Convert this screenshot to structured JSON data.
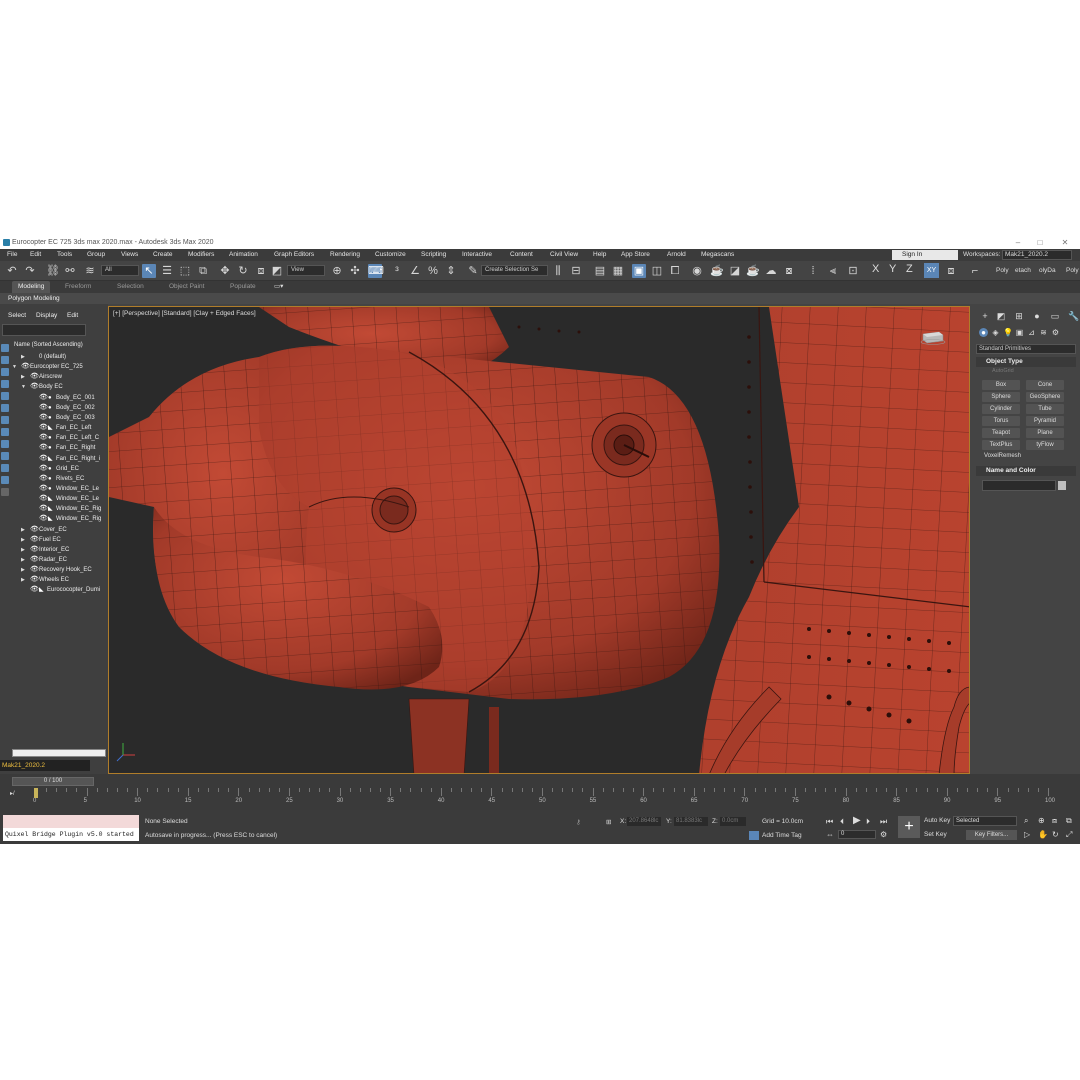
{
  "window": {
    "title": "Eurocopter EC 725 3ds max 2020.max - Autodesk 3ds Max 2020",
    "controls": [
      "–",
      "□",
      "✕"
    ]
  },
  "menu": [
    "File",
    "Edit",
    "Tools",
    "Group",
    "Views",
    "Create",
    "Modifiers",
    "Animation",
    "Graph Editors",
    "Rendering",
    "Customize",
    "Scripting",
    "Interactive",
    "Content",
    "Civil View",
    "Help",
    "App Store",
    "Arnold",
    "Megascans"
  ],
  "signin": "Sign In",
  "workspaces": {
    "label": "Workspaces:",
    "value": "Mak21_2020.2"
  },
  "toolbar": {
    "filter": "All",
    "refcoord": "View",
    "selection_set": "Create Selection Se",
    "axis_x": "X",
    "axis_y": "Y",
    "axis_z": "Z",
    "axis_xy": "XY",
    "poly": "Poly",
    "etach": "etach",
    "olyda": "olyDa",
    "poly2": "Poly"
  },
  "ribbon": {
    "tabs": [
      "Modeling",
      "Freeform",
      "Selection",
      "Object Paint",
      "Populate"
    ],
    "sub": "Polygon Modeling"
  },
  "scene": {
    "tabs": [
      "Select",
      "Display",
      "Edit"
    ],
    "header": "Name (Sorted Ascending)",
    "rows": [
      {
        "label": "0 (default)",
        "indent": 1,
        "tri": "▶",
        "eye": "",
        "dot": ""
      },
      {
        "label": "Eurocopter EC_725",
        "indent": 0,
        "tri": "▼",
        "eye": "👁",
        "dot": ""
      },
      {
        "label": "Airscrew",
        "indent": 1,
        "tri": "▶",
        "eye": "👁",
        "dot": ""
      },
      {
        "label": "Body EC",
        "indent": 1,
        "tri": "▼",
        "eye": "👁",
        "dot": ""
      },
      {
        "label": "Body_EC_001",
        "indent": 2,
        "tri": "",
        "eye": "👁",
        "dot": "●"
      },
      {
        "label": "Body_EC_002",
        "indent": 2,
        "tri": "",
        "eye": "👁",
        "dot": "●"
      },
      {
        "label": "Body_EC_003",
        "indent": 2,
        "tri": "",
        "eye": "👁",
        "dot": "●"
      },
      {
        "label": "Fan_EC_Left",
        "indent": 2,
        "tri": "",
        "eye": "👁",
        "dot": "◣"
      },
      {
        "label": "Fan_EC_Left_C",
        "indent": 2,
        "tri": "",
        "eye": "👁",
        "dot": "●"
      },
      {
        "label": "Fan_EC_Right",
        "indent": 2,
        "tri": "",
        "eye": "👁",
        "dot": "●"
      },
      {
        "label": "Fan_EC_Right_i",
        "indent": 2,
        "tri": "",
        "eye": "👁",
        "dot": "◣"
      },
      {
        "label": "Grid_EC",
        "indent": 2,
        "tri": "",
        "eye": "👁",
        "dot": "●"
      },
      {
        "label": "Rivets_EC",
        "indent": 2,
        "tri": "",
        "eye": "👁",
        "dot": "●"
      },
      {
        "label": "Window_EC_Le",
        "indent": 2,
        "tri": "",
        "eye": "👁",
        "dot": "●"
      },
      {
        "label": "Window_EC_Le",
        "indent": 2,
        "tri": "",
        "eye": "👁",
        "dot": "◣"
      },
      {
        "label": "Window_EC_Rig",
        "indent": 2,
        "tri": "",
        "eye": "👁",
        "dot": "◣"
      },
      {
        "label": "Window_EC_Rig",
        "indent": 2,
        "tri": "",
        "eye": "👁",
        "dot": "◣"
      },
      {
        "label": "Cover_EC",
        "indent": 1,
        "tri": "▶",
        "eye": "👁",
        "dot": ""
      },
      {
        "label": "Fuel EC",
        "indent": 1,
        "tri": "▶",
        "eye": "👁",
        "dot": ""
      },
      {
        "label": "Interior_EC",
        "indent": 1,
        "tri": "▶",
        "eye": "👁",
        "dot": ""
      },
      {
        "label": "Radar_EC",
        "indent": 1,
        "tri": "▶",
        "eye": "👁",
        "dot": ""
      },
      {
        "label": "Recovery Hook_EC",
        "indent": 1,
        "tri": "▶",
        "eye": "👁",
        "dot": ""
      },
      {
        "label": "Wheels EC",
        "indent": 1,
        "tri": "▶",
        "eye": "👁",
        "dot": ""
      },
      {
        "label": "Eurococopter_Dumi",
        "indent": 1,
        "tri": "",
        "eye": "👁",
        "dot": "◣"
      }
    ],
    "layer": "Mak21_2020.2"
  },
  "viewport": {
    "label": "[+] [Perspective] [Standard] [Clay + Edged Faces]"
  },
  "command_panel": {
    "primitives": "Standard Primitives",
    "object_type": "Object Type",
    "autogrid": "AutoGrid",
    "buttons": [
      "Box",
      "Cone",
      "Sphere",
      "GeoSphere",
      "Cylinder",
      "Tube",
      "Torus",
      "Pyramid",
      "Teapot",
      "Plane",
      "TextPlus",
      "tyFlow"
    ],
    "voxel": "VoxelRemesh",
    "name_color": "Name and Color"
  },
  "time": {
    "slider": "0 / 100",
    "ticks": [
      "0",
      "5",
      "10",
      "15",
      "20",
      "25",
      "30",
      "35",
      "40",
      "45",
      "50",
      "55",
      "60",
      "65",
      "70",
      "75",
      "80",
      "85",
      "90",
      "95",
      "100"
    ]
  },
  "status": {
    "quixel": "Quixel Bridge Plugin v5.0 started",
    "selected": "None Selected",
    "prompt": "Autosave in progress... (Press ESC to cancel)",
    "x_label": "X:",
    "x": "207.8648lc",
    "y_label": "Y:",
    "y": "81.8383lc",
    "z_label": "Z:",
    "z": "0.0cm",
    "grid": "Grid = 10.0cm",
    "add_time_tag": "Add Time Tag",
    "frame": "0",
    "auto_key": "Auto Key",
    "set_key": "Set Key",
    "selected_mode": "Selected",
    "key_filters": "Key Filters..."
  },
  "colors": {
    "model": "#b5412e",
    "viewport_bg": "#2a2a2a",
    "accent": "#5b86b6",
    "viewport_border": "#b07d2a"
  }
}
